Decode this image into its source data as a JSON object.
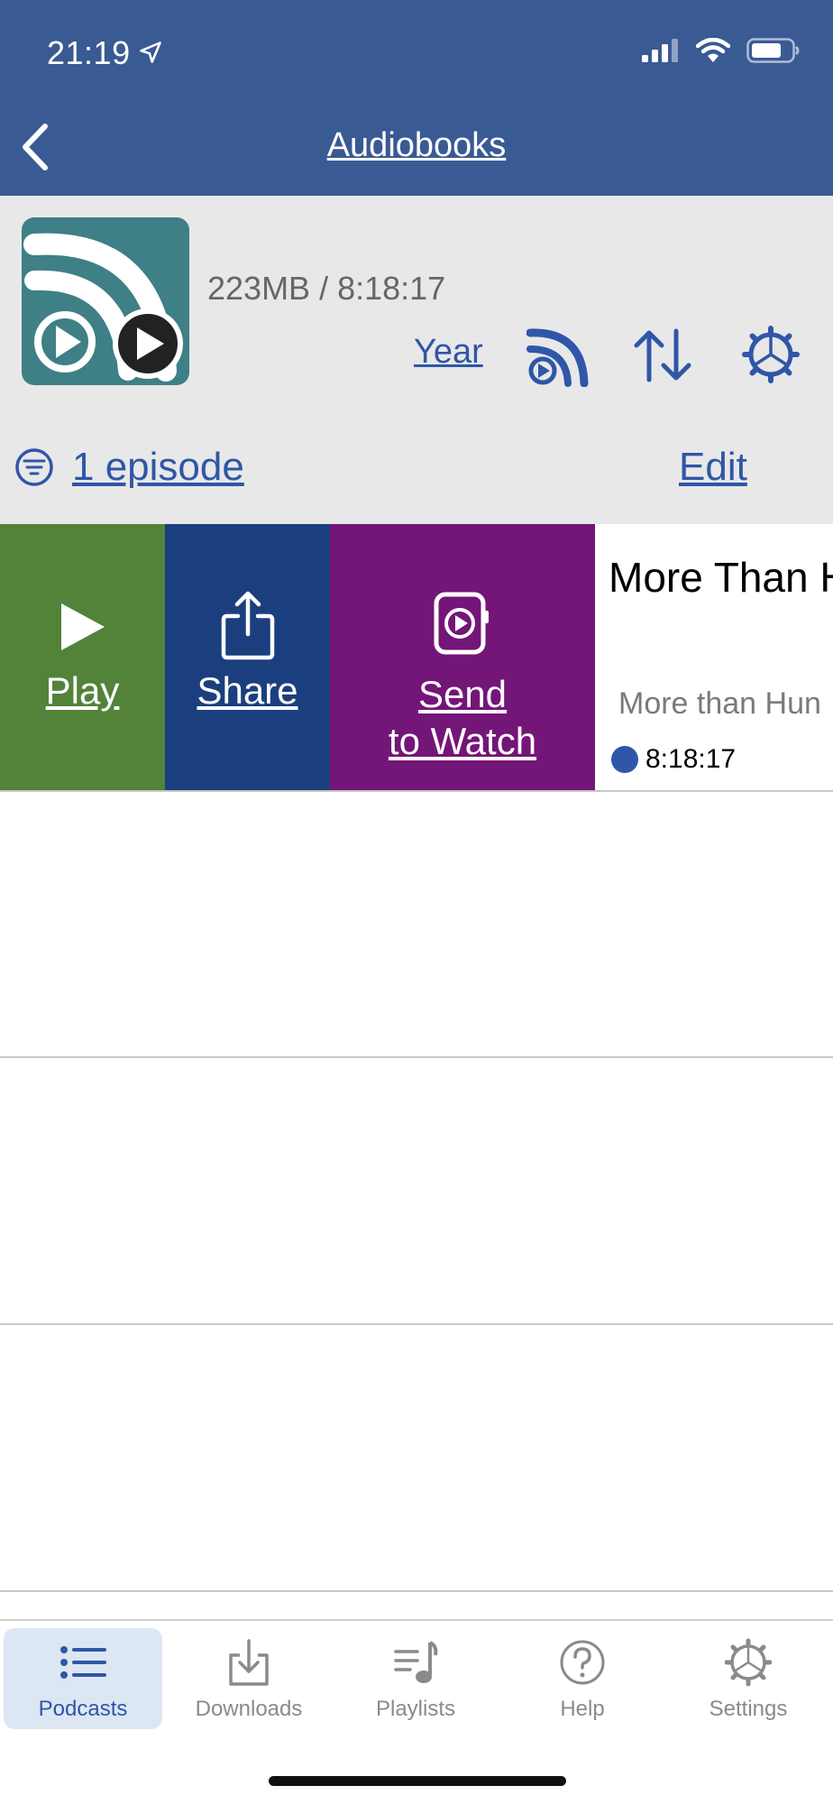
{
  "status_bar": {
    "time": "21:19"
  },
  "nav": {
    "title": "Audiobooks"
  },
  "podcast": {
    "size_duration": "223MB / 8:18:17",
    "year_label": "Year",
    "episode_count": "1 episode",
    "edit_label": "Edit"
  },
  "swipe_actions": {
    "play": "Play",
    "share": "Share",
    "send_line1": "Send",
    "send_line2": "to Watch"
  },
  "episode": {
    "title": "More Than H",
    "subtitle": "More than Hun",
    "duration": "8:18:17"
  },
  "tabs": [
    {
      "label": "Podcasts",
      "icon": "list-icon",
      "active": true
    },
    {
      "label": "Downloads",
      "icon": "download-icon",
      "active": false
    },
    {
      "label": "Playlists",
      "icon": "playlist-icon",
      "active": false
    },
    {
      "label": "Help",
      "icon": "help-icon",
      "active": false
    },
    {
      "label": "Settings",
      "icon": "gear-icon",
      "active": false
    }
  ],
  "colors": {
    "header": "#3a5a94",
    "accent": "#2f56a8",
    "play": "#528339",
    "share": "#1b3f7e",
    "send_to_watch": "#741578"
  }
}
